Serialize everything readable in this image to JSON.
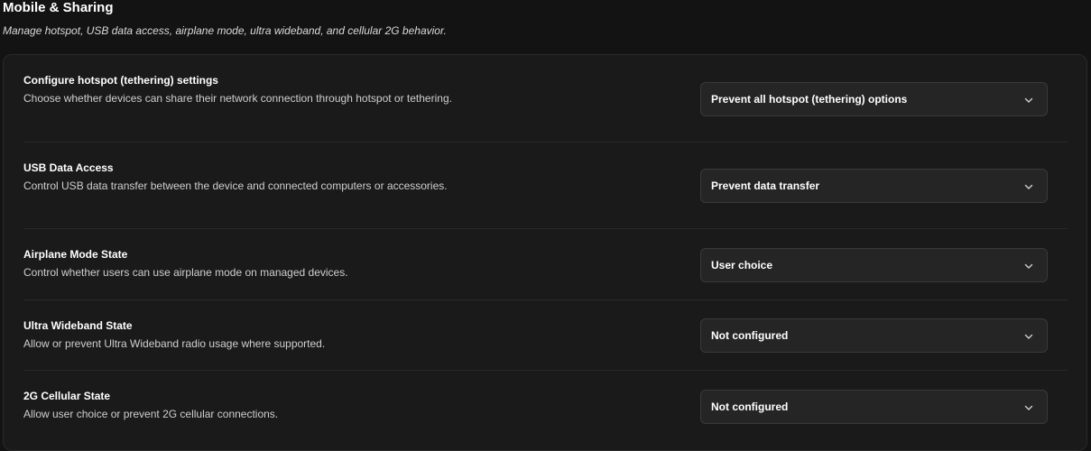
{
  "section": {
    "title": "Mobile & Sharing",
    "subtitle": "Manage hotspot, USB data access, airplane mode, ultra wideband, and cellular 2G behavior."
  },
  "settings": [
    {
      "title": "Configure hotspot (tethering) settings",
      "description": "Choose whether devices can share their network connection through hotspot or tethering.",
      "value": "Prevent all hotspot (tethering) options"
    },
    {
      "title": "USB Data Access",
      "description": "Control USB data transfer between the device and connected computers or accessories.",
      "value": "Prevent data transfer"
    },
    {
      "title": "Airplane Mode State",
      "description": "Control whether users can use airplane mode on managed devices.",
      "value": "User choice"
    },
    {
      "title": "Ultra Wideband State",
      "description": "Allow or prevent Ultra Wideband radio usage where supported.",
      "value": "Not configured"
    },
    {
      "title": "2G Cellular State",
      "description": "Allow user choice or prevent 2G cellular connections.",
      "value": "Not configured"
    }
  ],
  "icons": {
    "dropdown": "chevron-down-icon"
  }
}
